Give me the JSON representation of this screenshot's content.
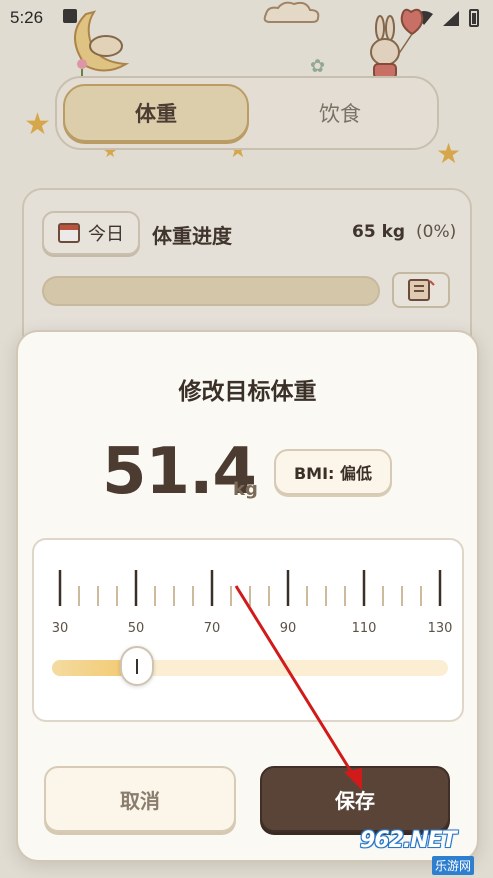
{
  "status_bar": {
    "time": "5:26"
  },
  "tabs": [
    {
      "label": "体重",
      "active": true
    },
    {
      "label": "饮食",
      "active": false
    }
  ],
  "progress_card": {
    "today_label": "今日",
    "title": "体重进度",
    "weight": "65 kg",
    "percent": "(0%)",
    "progress_fraction": 0
  },
  "modal": {
    "title": "修改目标体重",
    "weight_value": "51.4",
    "weight_unit": "kg",
    "bmi_label": "BMI: 偏低",
    "ruler": {
      "min": 30,
      "max": 130,
      "step": 5,
      "labels": [
        "30",
        "50",
        "70",
        "90",
        "110",
        "130"
      ],
      "current": 51.4
    },
    "cancel_label": "取消",
    "save_label": "保存"
  },
  "watermark": {
    "logo": "962.NET",
    "sub": "乐游网"
  },
  "colors": {
    "accent_dark": "#5a4438",
    "accent_gold": "#f2c76a",
    "arrow": "#d11a1a",
    "background": "#f3efe4"
  },
  "icons": [
    "wifi-icon",
    "signal-icon",
    "battery-icon",
    "calendar-icon",
    "notebook-icon",
    "slider-thumb-icon"
  ]
}
